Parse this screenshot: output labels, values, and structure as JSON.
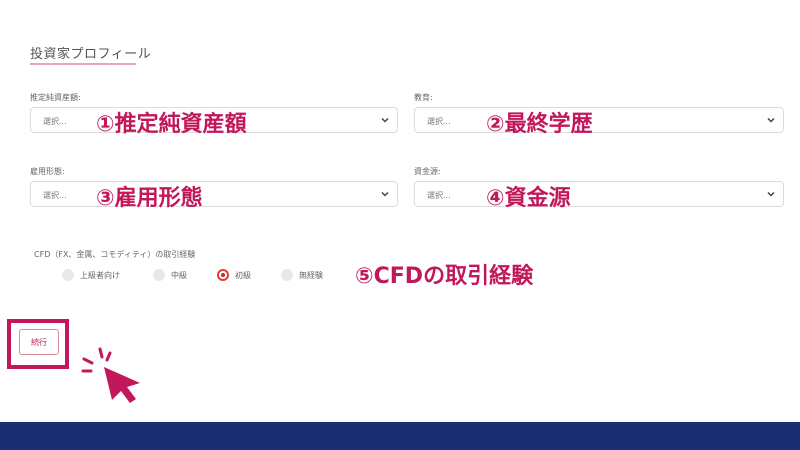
{
  "section": {
    "title": "投資家プロフィール"
  },
  "fields": [
    {
      "label": "推定純資産額:",
      "value": "選択...",
      "callout": "①推定純資産額"
    },
    {
      "label": "教育:",
      "value": "選択...",
      "callout": "②最終学歴"
    },
    {
      "label": "雇用形態:",
      "value": "選択...",
      "callout": "③雇用形態"
    },
    {
      "label": "資金源:",
      "value": "選択...",
      "callout": "④資金源"
    }
  ],
  "cfd": {
    "label": "CFD（FX、金属、コモディティ）の取引経験",
    "options": [
      {
        "label": "上級者向け",
        "selected": false
      },
      {
        "label": "中級",
        "selected": false
      },
      {
        "label": "初級",
        "selected": true
      },
      {
        "label": "無経験",
        "selected": false
      }
    ],
    "callout": "⑤CFDの取引経験"
  },
  "continue_button": {
    "label": "続行"
  },
  "colors": {
    "accent": "#c2185b",
    "footer": "#1a2f73",
    "radio_selected": "#e53935"
  },
  "icons": [
    "chevron-down-icon",
    "click-cursor-icon"
  ]
}
